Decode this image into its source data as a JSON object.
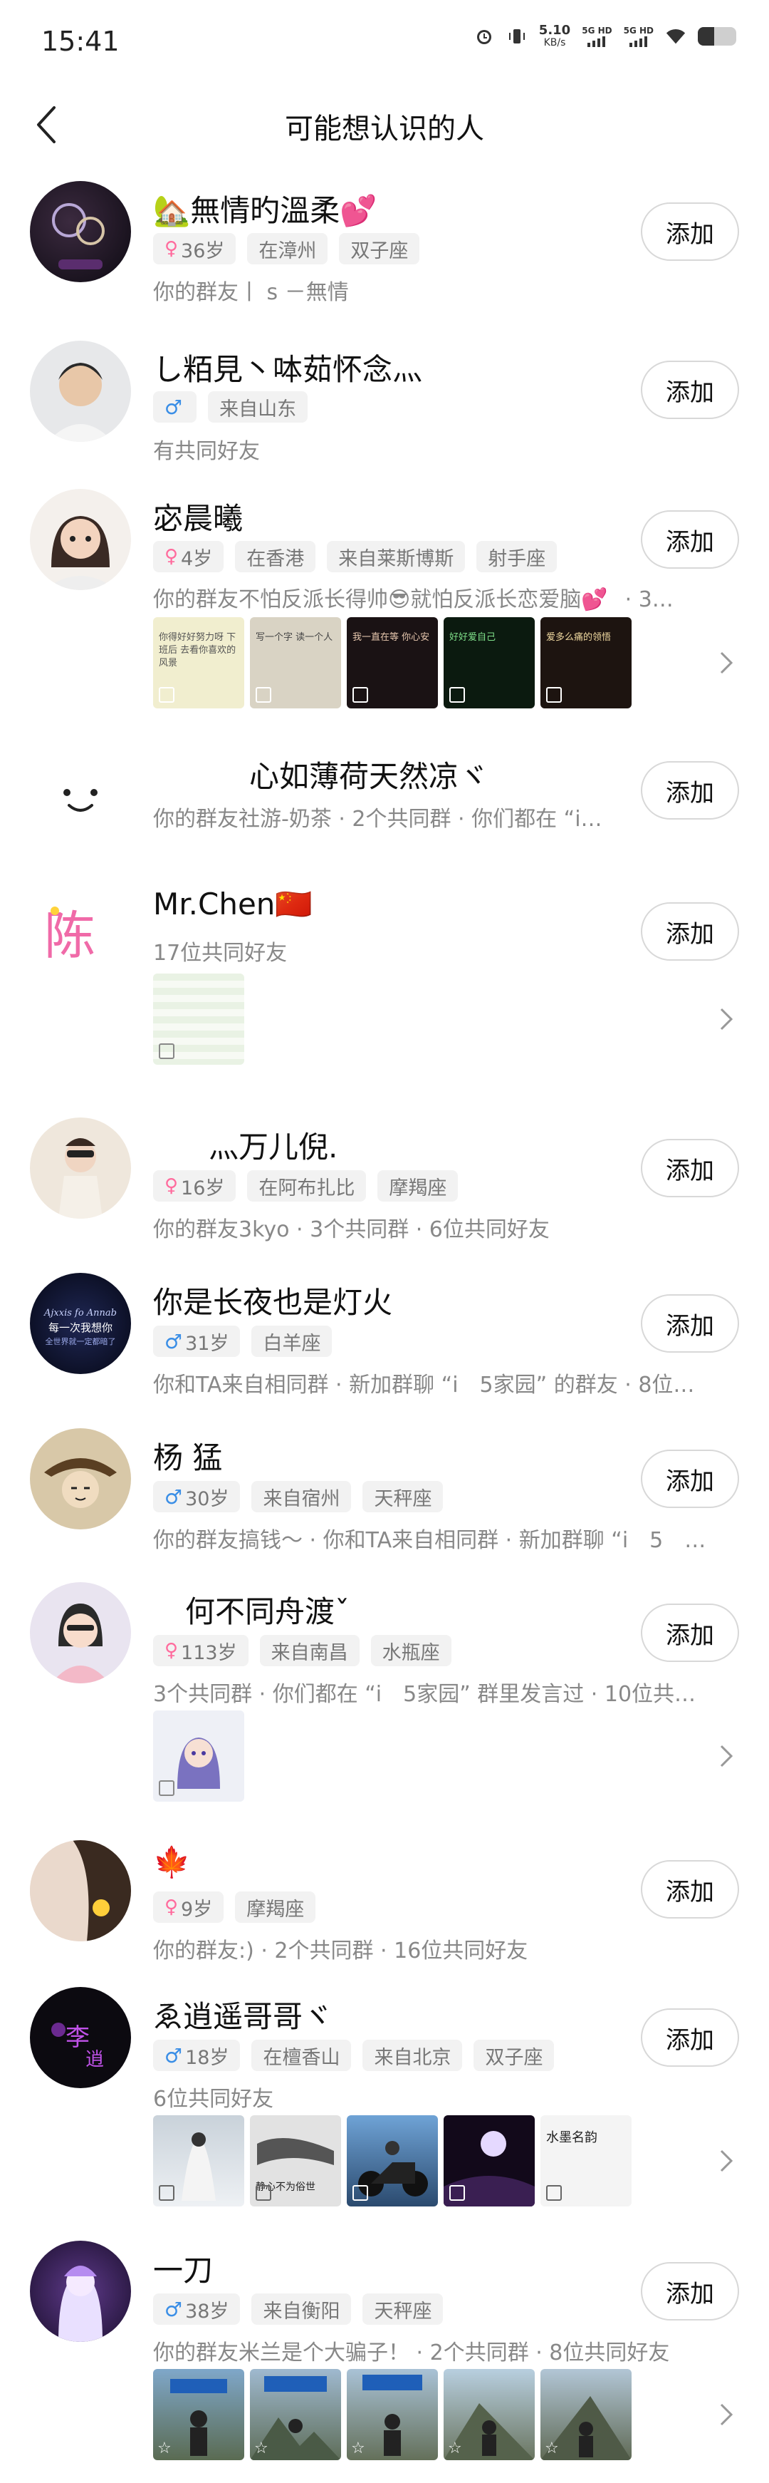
{
  "status": {
    "time": "15:41",
    "speed": "5.10",
    "speed_unit": "KB/s",
    "net1": "5G HD",
    "net2": "5G HD"
  },
  "header": {
    "title": "可能想认识的人"
  },
  "add_label": "添加",
  "items": [
    {
      "name": "🏡無情旳溫柔💕",
      "gender": "female",
      "age": "36岁",
      "tags": [
        "在漳州",
        "双子座"
      ],
      "desc": "你的群友丨 s －無情"
    },
    {
      "name": "し粨見丶呠茹怀念灬",
      "gender": "male",
      "age": "",
      "tags": [
        "来自山东"
      ],
      "desc": "有共同好友"
    },
    {
      "name": "宓晨曦",
      "gender": "female",
      "age": "4岁",
      "tags": [
        "在香港",
        "来自莱斯博斯",
        "射手座"
      ],
      "desc": "你的群友不怕反派长得帅😎就怕反派长恋爱脑💕",
      "desc_tail": "· 3…",
      "photos": 5
    },
    {
      "name": "心如薄荷天然凉ヾ",
      "gender": "",
      "age": "",
      "tags": [],
      "desc": "你的群友社游-奶茶 · 2个共同群 · 你们都在 “i…"
    },
    {
      "name": "Mr.Chen🇨🇳",
      "gender": "",
      "age": "",
      "tags": [],
      "desc": "17位共同好友",
      "photos": 1
    },
    {
      "name": "灬万儿倪.",
      "gender": "female",
      "age": "16岁",
      "tags": [
        "在阿布扎比",
        "摩羯座"
      ],
      "desc": "你的群友3kyo · 3个共同群 · 6位共同好友"
    },
    {
      "name": "你是长夜也是灯火",
      "gender": "male",
      "age": "31岁",
      "tags": [
        "白羊座"
      ],
      "desc": "你和TA来自相同群 · 新加群聊 “i　5家园” 的群友 · 8位…"
    },
    {
      "name": "杨 猛",
      "gender": "male",
      "age": "30岁",
      "tags": [
        "来自宿州",
        "天秤座"
      ],
      "desc": "你的群友搞钱～ · 你和TA来自相同群 · 新加群聊 “i　5　…"
    },
    {
      "name": "何不同舟渡ˇ",
      "gender": "female",
      "age": "113岁",
      "tags": [
        "来自南昌",
        "水瓶座"
      ],
      "desc": "3个共同群 · 你们都在 “i　5家园” 群里发言过 · 10位共…",
      "photos": 1
    },
    {
      "name": "🍁",
      "gender": "female",
      "age": "9岁",
      "tags": [
        "摩羯座"
      ],
      "desc": "你的群友:) · 2个共同群 · 16位共同好友"
    },
    {
      "name": "ゑ逍遥哥哥ヾ",
      "gender": "male",
      "age": "18岁",
      "tags": [
        "在檀香山",
        "来自北京",
        "双子座"
      ],
      "desc": "6位共同好友",
      "photos": 5
    },
    {
      "name": "一刀",
      "gender": "male",
      "age": "38岁",
      "tags": [
        "来自衡阳",
        "天秤座"
      ],
      "desc": "你的群友米兰是个大骗子！ · 2个共同群 · 8位共同好友",
      "photos": 5
    }
  ],
  "photo_texts": {
    "i3p1": "你得好好努力呀 下班后 去看你喜欢的风景",
    "i3p2": "写一个字 读一个人",
    "i3p3": "我一直在等 你心安",
    "i3p4": "好好爱自己",
    "i3p5": "爱多么痛的领悟",
    "i11p2": "静心不为俗世",
    "i11p5": "水墨名韵"
  },
  "colors": {
    "gender_female": "#ff6b9d",
    "gender_male": "#3a8ee6",
    "tag_bg": "#f2f2f2",
    "button_border": "#d8d8d8"
  }
}
